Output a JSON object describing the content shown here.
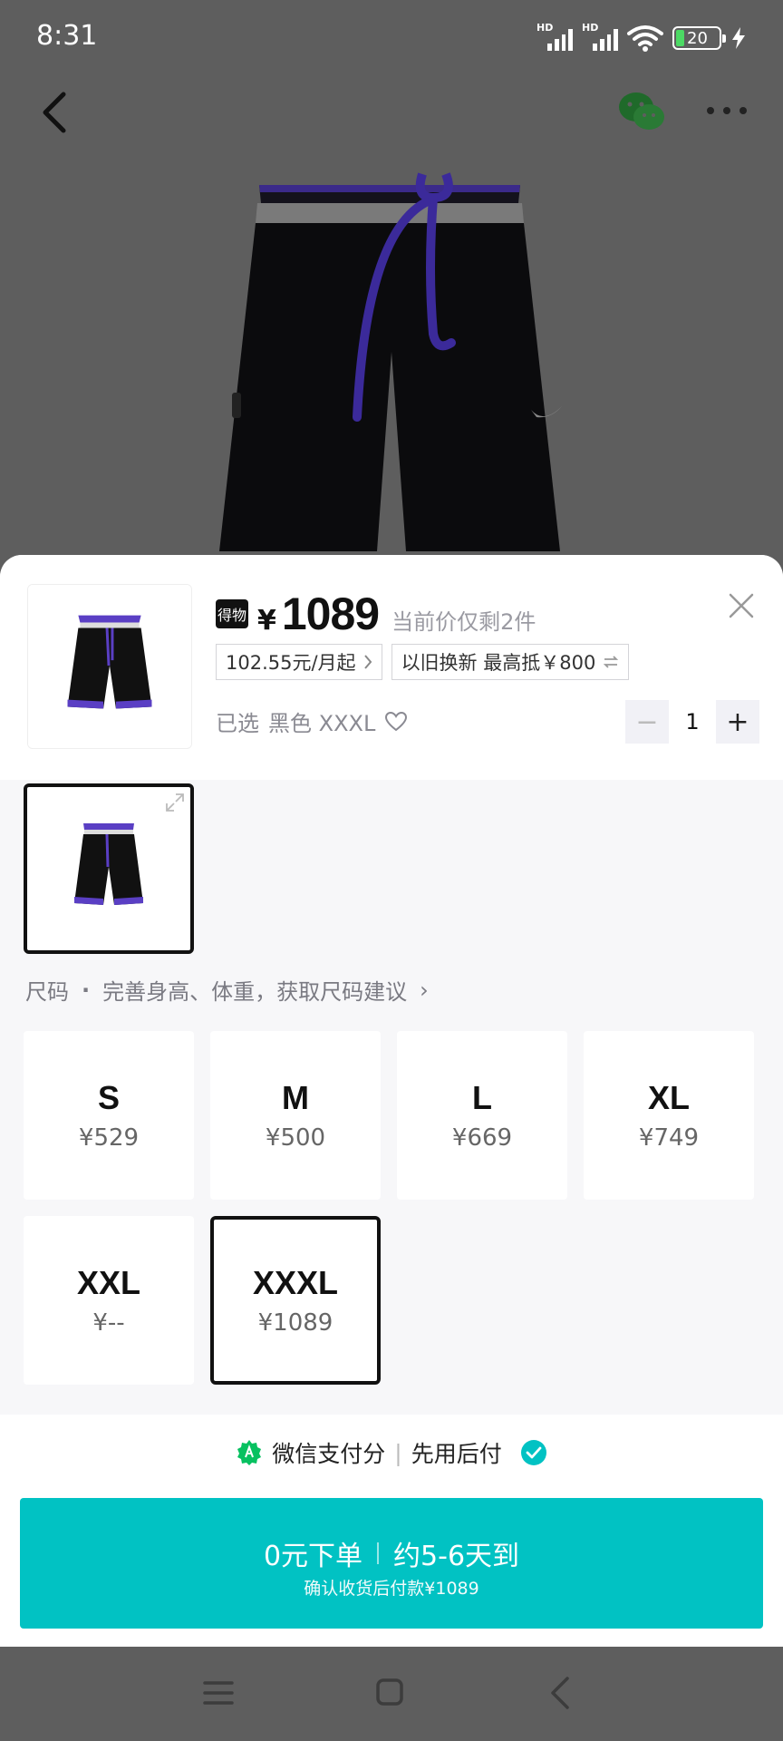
{
  "status_bar": {
    "time": "8:31",
    "signal_1_label": "HD",
    "signal_2_label": "HD",
    "battery": "20"
  },
  "nav": {
    "back_icon": "chevron-left-icon",
    "share_icon": "wechat-icon",
    "more_icon": "more-dots-icon"
  },
  "product": {
    "badge": "得物",
    "currency": "¥",
    "price": "1089",
    "stock_note": "当前价仅剩2件",
    "installment_tag": "102.55元/月起",
    "tradein_tag": "以旧换新 最高抵￥800",
    "selected_prefix": "已选",
    "selected_value": "黑色 XXXL",
    "quantity": "1",
    "qty_minus": "−",
    "qty_plus": "+"
  },
  "size_section": {
    "label": "尺码",
    "dot": "·",
    "hint": "完善身高、体重，获取尺码建议",
    "hint_arrow": "›",
    "sizes": [
      {
        "name": "S",
        "price": "¥529",
        "selected": false
      },
      {
        "name": "M",
        "price": "¥500",
        "selected": false
      },
      {
        "name": "L",
        "price": "¥669",
        "selected": false
      },
      {
        "name": "XL",
        "price": "¥749",
        "selected": false
      },
      {
        "name": "XXL",
        "price": "¥--",
        "selected": false
      },
      {
        "name": "XXXL",
        "price": "¥1089",
        "selected": true
      }
    ]
  },
  "payment": {
    "provider": "微信支付分",
    "separator": "|",
    "option": "先用后付"
  },
  "order_button": {
    "main": "0元下单",
    "eta": "约5-6天到",
    "sub": "确认收货后付款¥1089"
  },
  "colors": {
    "accent": "#01c2c3",
    "sheet_bg": "#f7f7f9",
    "overlay": "#5e5e5e",
    "wechat_green": "#07c160"
  }
}
